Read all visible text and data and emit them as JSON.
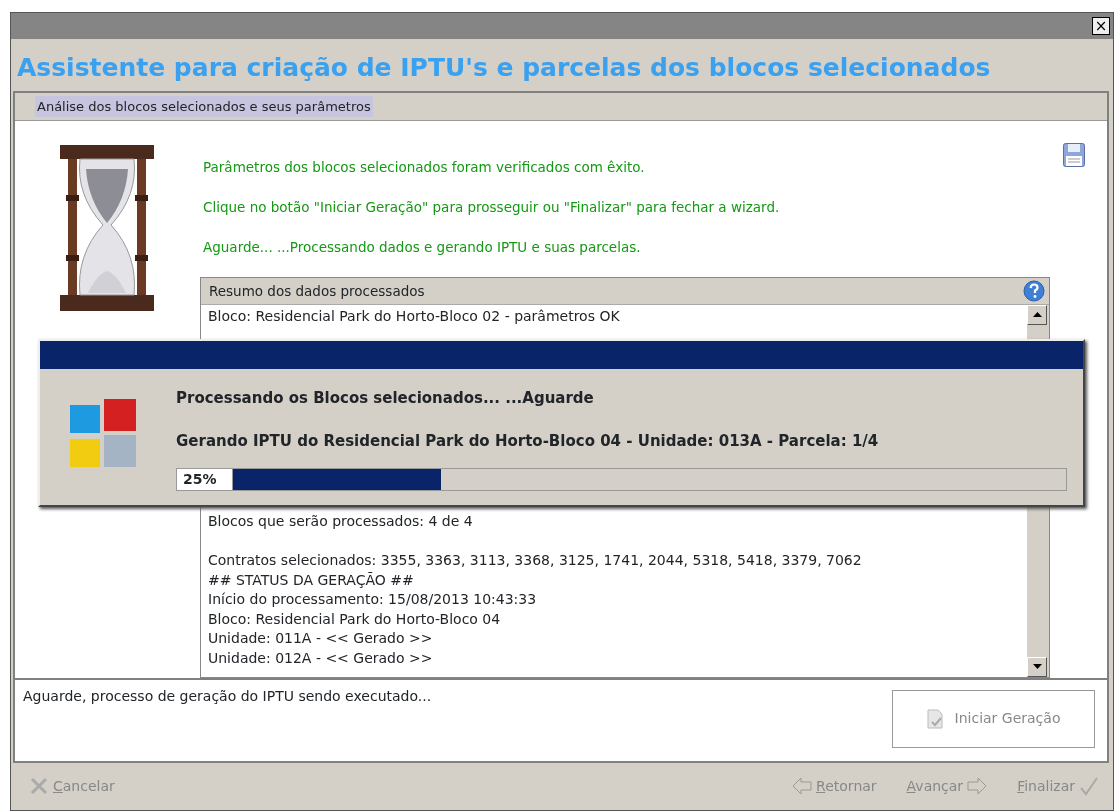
{
  "window": {
    "close_label": "×",
    "heading": "Assistente para criação de IPTU's e parcelas dos blocos selecionados"
  },
  "step": {
    "title": "Análise dos blocos selecionados e seus parâmetros"
  },
  "messages": [
    "Parâmetros dos blocos selecionados foram verificados com êxito.",
    "Clique no botão \"Iniciar Geração\" para prosseguir ou \"Finalizar\" para fechar a wizard.",
    "Aguarde...   ...Processando dados e gerando IPTU e suas parcelas."
  ],
  "log": {
    "title": "Resumo dos dados processados",
    "lines_top": [
      {
        "kind": "line",
        "text": "Bloco: Residencial Park do Horto-Bloco 02 - parâmetros OK"
      }
    ],
    "lines_bottom": [
      {
        "kind": "line",
        "text": "Blocos que serão processados: 4 de 4"
      },
      {
        "kind": "blank"
      },
      {
        "kind": "line",
        "text": "Contratos selecionados: 3355, 3363, 3113, 3368, 3125, 1741, 2044, 5318, 5418, 3379, 7062"
      },
      {
        "kind": "line",
        "text": "## STATUS DA GERAÇÃO ##"
      },
      {
        "kind": "line",
        "text": "Início do processamento: 15/08/2013 10:43:33"
      },
      {
        "kind": "line",
        "text": "Bloco: Residencial Park do Horto-Bloco 04"
      },
      {
        "kind": "line",
        "text": "Unidade: 011A - << Gerado >>"
      },
      {
        "kind": "line",
        "text": "Unidade: 012A - << Gerado >>"
      }
    ]
  },
  "progress_dialog": {
    "line_1": "Processando os Blocos selecionados...   ...Aguarde",
    "line_2": "Gerando IPTU do Residencial Park do Horto-Bloco 04 - Unidade: 013A - Parcela: 1/4",
    "percent": "25%",
    "level": 0.25
  },
  "status_text": "Aguarde, processo de geração do IPTU sendo executado...",
  "start_button": {
    "label": "Iniciar Geração",
    "disabled": true
  },
  "footer": [
    {
      "kind": "cancel",
      "label": "Cancelar",
      "disabled": true
    },
    {
      "kind": "back",
      "label": "Retornar",
      "disabled": true
    },
    {
      "kind": "next",
      "label": "Avançar",
      "disabled": true
    },
    {
      "kind": "finish",
      "label": "Finalizar",
      "disabled": true
    }
  ]
}
